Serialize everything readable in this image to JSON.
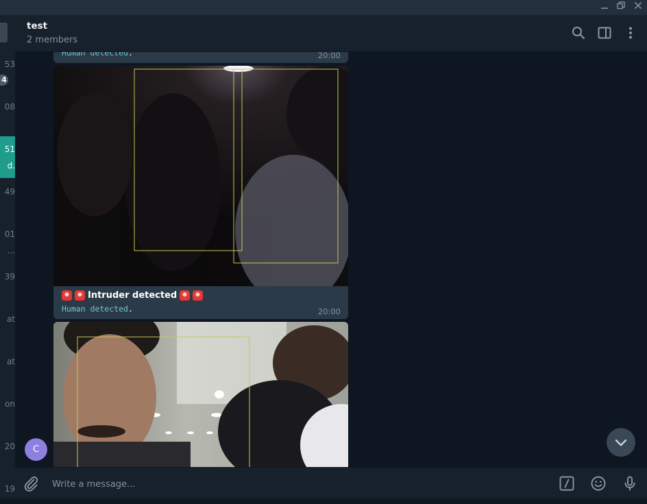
{
  "window": {
    "minimize_icon": "minimize-icon",
    "restore_icon": "restore-icon",
    "close_icon": "close-icon"
  },
  "chat_list_partial": {
    "items": [
      {
        "text": "53"
      },
      {
        "text": "4",
        "unread": true
      },
      {
        "text": "08"
      },
      {
        "text": "51",
        "active": true
      },
      {
        "text": "d.",
        "active": true
      },
      {
        "text": "49"
      },
      {
        "text": "01"
      },
      {
        "text": "..."
      },
      {
        "text": "39"
      },
      {
        "text": "at"
      },
      {
        "text": "at"
      },
      {
        "text": "on"
      },
      {
        "text": "20"
      },
      {
        "text": "19"
      }
    ]
  },
  "header": {
    "title": "test",
    "subtitle": "2 members",
    "icons": [
      "search-icon",
      "sidebar-toggle-icon",
      "more-vert-icon"
    ]
  },
  "messages": [
    {
      "type": "caption-fragment",
      "code_text": "Human detected",
      "suffix": ".",
      "time": "20:00"
    },
    {
      "type": "photo",
      "title": "Intruder detected",
      "code_text": "Human detected",
      "suffix": ".",
      "time": "20:00"
    },
    {
      "type": "photo"
    }
  ],
  "sender_avatar": {
    "initial": "C",
    "color": "#8e7fe0"
  },
  "composer": {
    "placeholder": "Write a message...",
    "icons": [
      "attach-icon",
      "bot-command-icon",
      "emoji-icon",
      "microphone-icon"
    ]
  },
  "colors": {
    "background": "#0e1621",
    "panel": "#17212b",
    "bubble": "#2b3a48",
    "accent": "#1e9c8c",
    "code": "#6cc9c9",
    "detection_box": "#c9c75a"
  }
}
